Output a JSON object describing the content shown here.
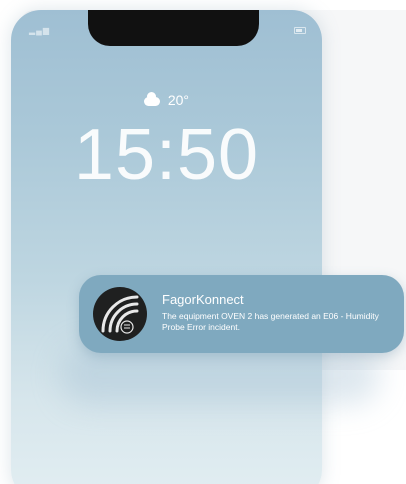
{
  "lock_screen": {
    "weather": {
      "icon": "cloud-icon",
      "temperature": "20°"
    },
    "time": "15:50"
  },
  "notification": {
    "app_icon": "fagor-app-icon",
    "app_name": "FagorKonnect",
    "message": "The equipment OVEN 2 has generated an E06 - Humidity Probe Error incident."
  },
  "colors": {
    "notification_bg": "#7fa9bf",
    "app_icon_bg": "#1f2020",
    "wallpaper_top": "#9fbfd3",
    "wallpaper_bottom": "#e2eef2"
  }
}
